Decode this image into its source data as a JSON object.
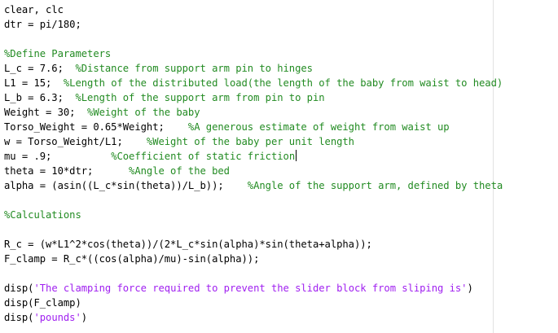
{
  "editor": {
    "theme": {
      "background": "#ffffff",
      "code_color": "#000000",
      "comment_color": "#228b22",
      "string_color": "#a020f0",
      "margin_line_color": "#e2e2e2"
    },
    "lines": [
      [
        {
          "t": "code",
          "v": "clear, clc"
        }
      ],
      [
        {
          "t": "code",
          "v": "dtr = pi/180;"
        }
      ],
      [],
      [
        {
          "t": "comment",
          "v": "%Define Parameters"
        }
      ],
      [
        {
          "t": "code",
          "v": "L_c = 7.6;  "
        },
        {
          "t": "comment",
          "v": "%Distance from support arm pin to hinges"
        }
      ],
      [
        {
          "t": "code",
          "v": "L1 = 15;  "
        },
        {
          "t": "comment",
          "v": "%Length of the distributed load(the length of the baby from waist to head)"
        }
      ],
      [
        {
          "t": "code",
          "v": "L_b = 6.3;  "
        },
        {
          "t": "comment",
          "v": "%Length of the support arm from pin to pin"
        }
      ],
      [
        {
          "t": "code",
          "v": "Weight = 30;  "
        },
        {
          "t": "comment",
          "v": "%Weight of the baby"
        }
      ],
      [
        {
          "t": "code",
          "v": "Torso_Weight = 0.65*Weight;    "
        },
        {
          "t": "comment",
          "v": "%A generous estimate of weight from waist up"
        }
      ],
      [
        {
          "t": "code",
          "v": "w = Torso_Weight/L1;    "
        },
        {
          "t": "comment",
          "v": "%Weight of the baby per unit length"
        }
      ],
      [
        {
          "t": "code",
          "v": "mu = .9;          "
        },
        {
          "t": "comment",
          "v": "%Coefficient of static friction"
        },
        {
          "t": "caret",
          "v": ""
        }
      ],
      [
        {
          "t": "code",
          "v": "theta = 10*dtr;      "
        },
        {
          "t": "comment",
          "v": "%Angle of the bed"
        }
      ],
      [
        {
          "t": "code",
          "v": "alpha = (asin((L_c*sin(theta))/L_b));    "
        },
        {
          "t": "comment",
          "v": "%Angle of the support arm, defined by theta"
        }
      ],
      [],
      [
        {
          "t": "comment",
          "v": "%Calculations"
        }
      ],
      [],
      [
        {
          "t": "code",
          "v": "R_c = (w*L1^2*cos(theta))/(2*L_c*sin(alpha)*sin(theta+alpha));"
        }
      ],
      [
        {
          "t": "code",
          "v": "F_clamp = R_c*((cos(alpha)/mu)-sin(alpha));"
        }
      ],
      [],
      [
        {
          "t": "code",
          "v": "disp("
        },
        {
          "t": "string",
          "v": "'The clamping force required to prevent the slider block from sliping is'"
        },
        {
          "t": "code",
          "v": ")"
        }
      ],
      [
        {
          "t": "code",
          "v": "disp(F_clamp)"
        }
      ],
      [
        {
          "t": "code",
          "v": "disp("
        },
        {
          "t": "string",
          "v": "'pounds'"
        },
        {
          "t": "code",
          "v": ")"
        }
      ]
    ]
  }
}
